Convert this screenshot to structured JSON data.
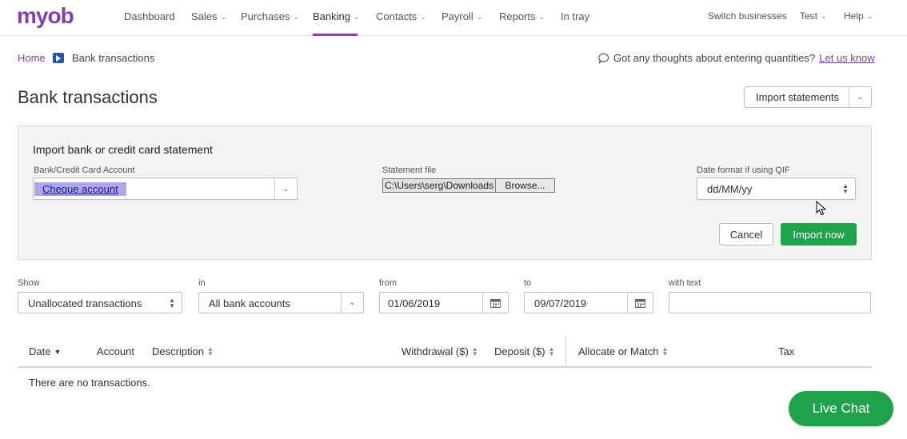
{
  "brand": {
    "logo_text": "myob",
    "accent_color": "#8241aa",
    "primary_button_color": "#1fa34a"
  },
  "nav": {
    "items": [
      {
        "label": "Dashboard",
        "has_menu": false
      },
      {
        "label": "Sales",
        "has_menu": true
      },
      {
        "label": "Purchases",
        "has_menu": true
      },
      {
        "label": "Banking",
        "has_menu": true,
        "active": true
      },
      {
        "label": "Contacts",
        "has_menu": true
      },
      {
        "label": "Payroll",
        "has_menu": true
      },
      {
        "label": "Reports",
        "has_menu": true
      },
      {
        "label": "In tray",
        "has_menu": false
      }
    ],
    "right": [
      {
        "label": "Switch businesses",
        "has_menu": false
      },
      {
        "label": "Test",
        "has_menu": true
      },
      {
        "label": "Help",
        "has_menu": true
      }
    ]
  },
  "breadcrumb": {
    "home": "Home",
    "current": "Bank transactions"
  },
  "feedback": {
    "text": "Got any thoughts about entering quantities?",
    "link": "Let us know"
  },
  "page": {
    "title": "Bank transactions",
    "import_statements_label": "Import statements"
  },
  "import_panel": {
    "title": "Import bank or credit card statement",
    "account_label": "Bank/Credit Card Account",
    "account_value": "Cheque account",
    "file_label": "Statement file",
    "file_path": "C:\\Users\\serg\\Downloads",
    "browse_label": "Browse...",
    "date_format_label": "Date format if using QIF",
    "date_format_value": "dd/MM/yy",
    "cancel_label": "Cancel",
    "import_now_label": "Import now"
  },
  "filters": {
    "show_label": "Show",
    "show_value": "Unallocated transactions",
    "in_label": "in",
    "in_value": "All bank accounts",
    "from_label": "from",
    "from_value": "01/06/2019",
    "to_label": "to",
    "to_value": "09/07/2019",
    "text_label": "with text",
    "text_value": ""
  },
  "table": {
    "columns": {
      "date": "Date",
      "account": "Account",
      "description": "Description",
      "withdrawal": "Withdrawal ($)",
      "deposit": "Deposit ($)",
      "allocate": "Allocate or Match",
      "tax": "Tax"
    },
    "empty_message": "There are no transactions."
  },
  "live_chat": {
    "label": "Live Chat"
  }
}
